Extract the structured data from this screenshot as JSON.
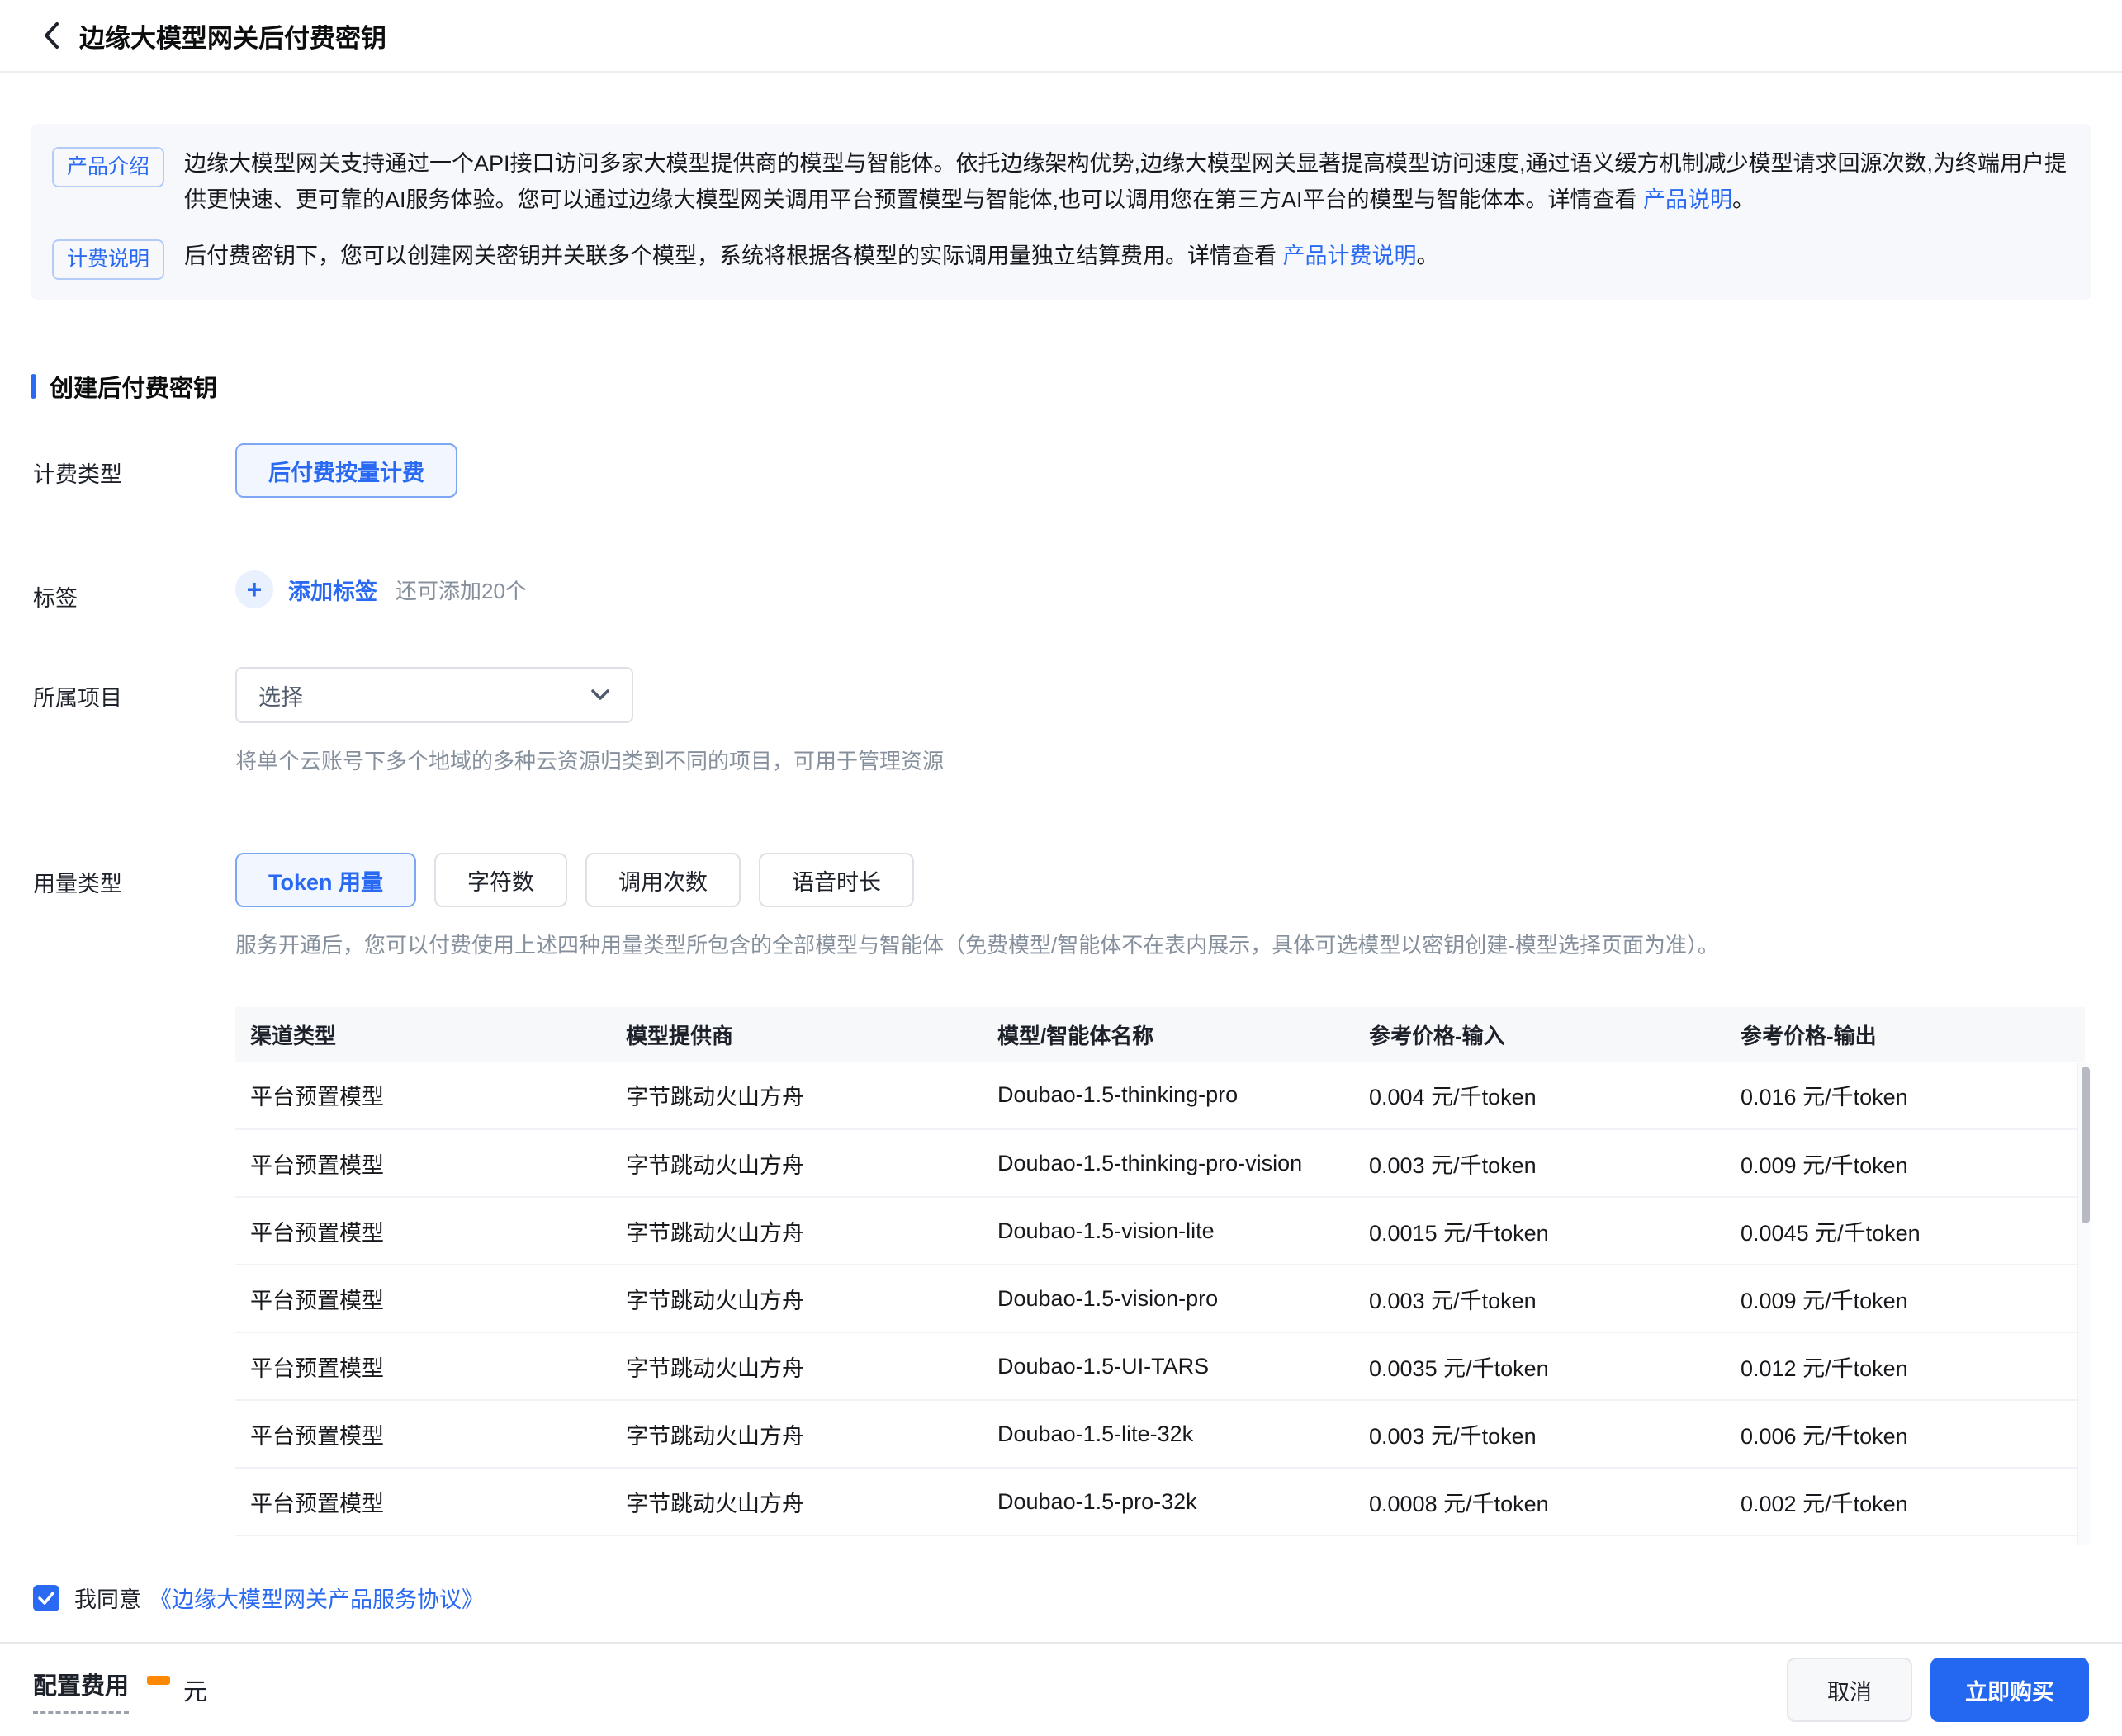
{
  "header": {
    "title": "边缘大模型网关后付费密钥"
  },
  "icons": {
    "back": "‹",
    "plus": "+",
    "chevron_down": "⌄",
    "check": "✓"
  },
  "colors": {
    "accent_blue": "#2a6af2",
    "buy_button_blue": "#2468f2",
    "banner_bg": "#f7f8fc",
    "orange_dash": "#ff8800",
    "gray_text": "#86909c"
  },
  "notices": {
    "product": {
      "badge": "产品介绍",
      "text": "边缘大模型网关支持通过一个API接口访问多家大模型提供商的模型与智能体。依托边缘架构优势,边缘大模型网关显著提高模型访问速度,通过语义缓方机制减少模型请求回源次数,为终端用户提供更快速、更可靠的AI服务体验。您可以通过边缘大模型网关调用平台预置模型与智能体,也可以调用您在第三方AI平台的模型与智能体本。详情查看 ",
      "link": "产品说明",
      "suffix": "。"
    },
    "billing": {
      "badge": "计费说明",
      "text": "后付费密钥下，您可以创建网关密钥并关联多个模型，系统将根据各模型的实际调用量独立结算费用。详情查看 ",
      "link": "产品计费说明",
      "suffix": "。"
    }
  },
  "section": {
    "title": "创建后付费密钥"
  },
  "form": {
    "billing_type": {
      "label": "计费类型",
      "selected_option": "后付费按量计费"
    },
    "tags": {
      "label": "标签",
      "add_label": "添加标签",
      "hint": "还可添加20个"
    },
    "project": {
      "label": "所属项目",
      "placeholder": "选择",
      "helper": "将单个云账号下多个地域的多种云资源归类到不同的项目，可用于管理资源"
    },
    "usage_type": {
      "label": "用量类型",
      "options": [
        "Token 用量",
        "字符数",
        "调用次数",
        "语音时长"
      ],
      "selected": "Token 用量",
      "helper": "服务开通后，您可以付费使用上述四种用量类型所包含的全部模型与智能体（免费模型/智能体不在表内展示，具体可选模型以密钥创建-模型选择页面为准）。"
    }
  },
  "table": {
    "columns": [
      "渠道类型",
      "模型提供商",
      "模型/智能体名称",
      "参考价格-输入",
      "参考价格-输出"
    ],
    "rows": [
      [
        "平台预置模型",
        "字节跳动火山方舟",
        "Doubao-1.5-thinking-pro",
        "0.004 元/千token",
        "0.016 元/千token"
      ],
      [
        "平台预置模型",
        "字节跳动火山方舟",
        "Doubao-1.5-thinking-pro-vision",
        "0.003 元/千token",
        "0.009 元/千token"
      ],
      [
        "平台预置模型",
        "字节跳动火山方舟",
        "Doubao-1.5-vision-lite",
        "0.0015 元/千token",
        "0.0045 元/千token"
      ],
      [
        "平台预置模型",
        "字节跳动火山方舟",
        "Doubao-1.5-vision-pro",
        "0.003 元/千token",
        "0.009 元/千token"
      ],
      [
        "平台预置模型",
        "字节跳动火山方舟",
        "Doubao-1.5-UI-TARS",
        "0.0035 元/千token",
        "0.012 元/千token"
      ],
      [
        "平台预置模型",
        "字节跳动火山方舟",
        "Doubao-1.5-lite-32k",
        "0.003 元/千token",
        "0.006 元/千token"
      ],
      [
        "平台预置模型",
        "字节跳动火山方舟",
        "Doubao-1.5-pro-32k",
        "0.0008 元/千token",
        "0.002 元/千token"
      ]
    ]
  },
  "agreement": {
    "checked": true,
    "text": "我同意",
    "link": "《边缘大模型网关产品服务协议》"
  },
  "footer": {
    "cost_label": "配置费用",
    "cost_unit": "元",
    "cancel_label": "取消",
    "buy_label": "立即购买"
  }
}
